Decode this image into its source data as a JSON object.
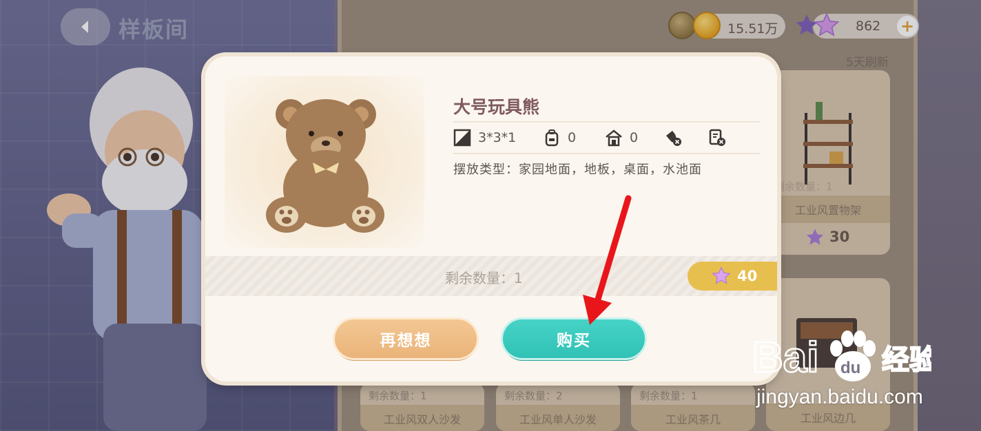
{
  "header": {
    "back_icon": "chevron-left-icon",
    "title": "样板间"
  },
  "currency": {
    "gold": "15.51万",
    "stars": "862",
    "plus": "+"
  },
  "shop": {
    "refresh": "5天刷新",
    "cards": [
      {
        "name": "工业风置物架",
        "remain": "剩余数量：1",
        "price": "30"
      },
      {
        "name": "工业风双人沙发",
        "remain": "剩余数量：1"
      },
      {
        "name": "工业风单人沙发",
        "remain": "剩余数量：2"
      },
      {
        "name": "工业风茶几",
        "remain": "剩余数量：1"
      },
      {
        "name": "工业风边几",
        "remain": ""
      }
    ]
  },
  "modal": {
    "item_name": "大号玩具熊",
    "stats": {
      "size": "3*3*1",
      "backpack": "0",
      "home": "0"
    },
    "placement": "摆放类型：家园地面，地板，桌面，水池面",
    "remaining": "剩余数量：1",
    "price": "40",
    "cancel_label": "再想想",
    "buy_label": "购买"
  },
  "watermark": {
    "url": "jingyan.baidu.com"
  },
  "colors": {
    "buy_button": "#35c6b9",
    "cancel_button": "#eebc85",
    "price_tag": "#e7bf4f",
    "annotation_arrow": "#e8161b"
  }
}
